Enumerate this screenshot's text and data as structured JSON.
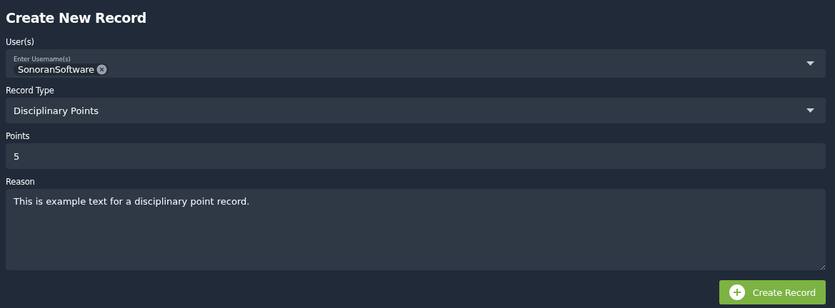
{
  "title": "Create New Record",
  "fields": [
    {
      "kind": "tags",
      "label": "User(s)",
      "floating_label": "Enter Username(s)",
      "tags": [
        "SonoranSoftware"
      ]
    },
    {
      "kind": "select",
      "label": "Record Type",
      "value": "Disciplinary Points"
    },
    {
      "kind": "input",
      "label": "Points",
      "value": "5"
    },
    {
      "kind": "textarea",
      "label": "Reason",
      "value": "This is example text for a disciplinary point record."
    }
  ],
  "submit": {
    "label": "Create Record"
  }
}
